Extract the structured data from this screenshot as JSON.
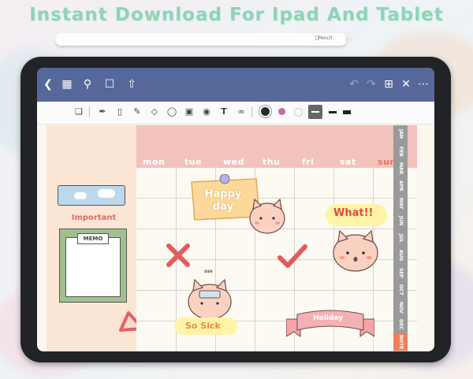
{
  "headline": "Instant Download For Ipad And Tablet",
  "pencil": {
    "label": "Pencil"
  },
  "colors": {
    "headline": "#8fd3b8",
    "navbar": "#56689a",
    "grid_header": "#f2c2bd",
    "sidebar": "#fbe6d6",
    "active_tab": "#f07f58",
    "tab": "#9a9a9a"
  },
  "navbar": {
    "left_icons": [
      "back-icon",
      "grid-icon",
      "search-icon",
      "bookmark-icon",
      "share-icon"
    ],
    "right_icons": [
      "undo-icon",
      "redo-icon",
      "add-page-icon",
      "close-icon",
      "more-icon"
    ]
  },
  "toolbar": {
    "icons": [
      "page-icon",
      "pen-icon",
      "eraser-icon",
      "highlighter-icon",
      "shapes-icon",
      "lasso-icon",
      "image-icon",
      "camera-icon",
      "text-icon",
      "link-icon"
    ],
    "selected_colors": [
      "#2b2b2b",
      "#c86aa7"
    ]
  },
  "planner": {
    "days": [
      "mon",
      "tue",
      "wed",
      "thu",
      "fri",
      "sat",
      "sun"
    ],
    "months": [
      "JAN",
      "FEB",
      "MAR",
      "APR",
      "MAY",
      "JUN",
      "JUL",
      "AUG",
      "SEP",
      "OCT",
      "NOV",
      "DEC",
      "NOTE"
    ],
    "active_month": "NOTE",
    "sidebar": {
      "important_label": "Important",
      "memo_label": "MEMO"
    },
    "stickers": {
      "happy_day": "Happy day",
      "what": "What!!",
      "so_sick": "So Sick",
      "holiday": "Holiday",
      "sss": "sss"
    }
  }
}
